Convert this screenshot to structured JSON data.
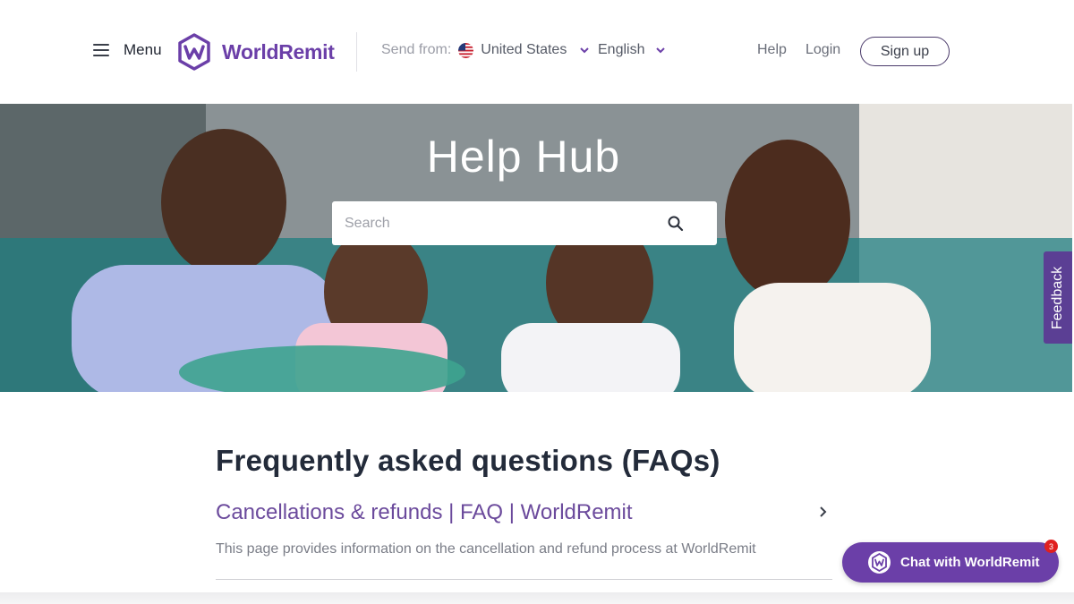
{
  "header": {
    "menu_label": "Menu",
    "logo_text": "WorldRemit",
    "send_from_label": "Send from:",
    "country": "United States",
    "language": "English",
    "help": "Help",
    "login": "Login",
    "signup": "Sign up"
  },
  "hero": {
    "title": "Help Hub",
    "search_placeholder": "Search"
  },
  "feedback_tab": "Feedback",
  "faq": {
    "heading": "Frequently asked questions (FAQs)",
    "items": [
      {
        "title": "Cancellations & refunds | FAQ | WorldRemit",
        "description": "This page provides information on the cancellation and refund process at WorldRemit"
      }
    ]
  },
  "chat": {
    "label": "Chat with WorldRemit",
    "badge_count": "3"
  },
  "colors": {
    "brand_purple": "#6b3fa8",
    "feedback_purple": "#5b3f94",
    "badge_red": "#e0201f"
  },
  "icons": {
    "menu": "hamburger-icon",
    "logo": "worldremit-logo",
    "flag": "us-flag-icon",
    "dropdown": "chevron-down-icon",
    "search": "search-icon",
    "faq_arrow": "chevron-right-icon"
  }
}
